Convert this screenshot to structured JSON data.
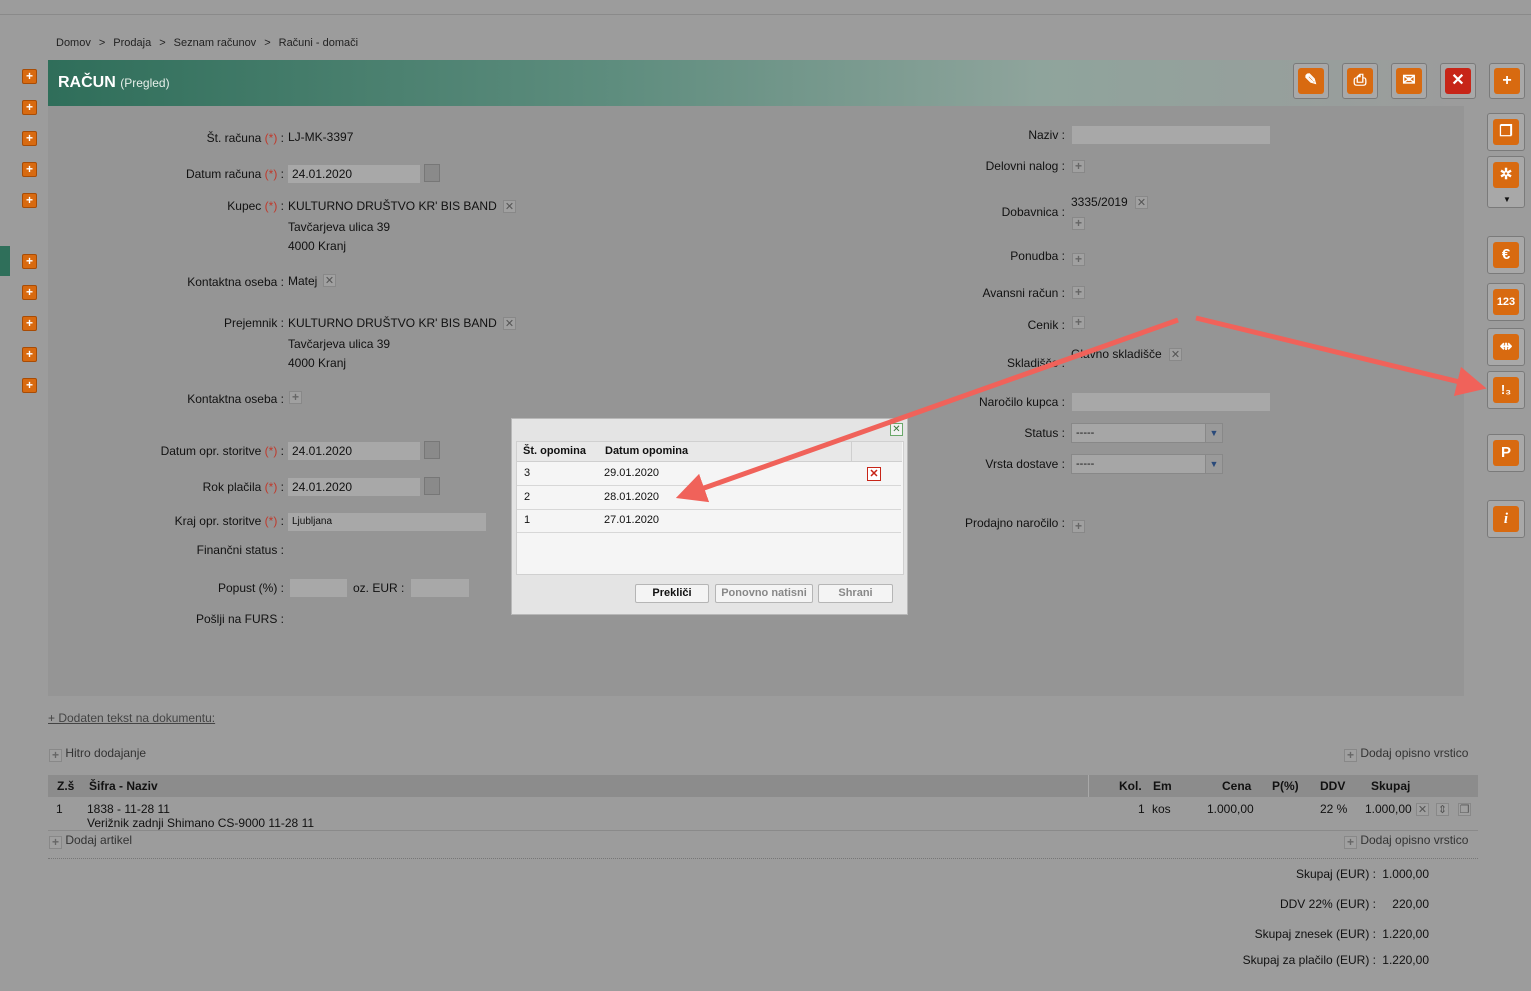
{
  "breadcrumb": {
    "items": [
      "Domov",
      "Prodaja",
      "Seznam računov",
      "Računi - domači"
    ],
    "separator": ">"
  },
  "header": {
    "title": "RAČUN",
    "subtitle": "(Pregled)"
  },
  "required_mark": "(*)",
  "form_left": {
    "st_racuna_label": "Št. računa",
    "st_racuna_value": "LJ-MK-3397",
    "datum_racuna_label": "Datum računa",
    "datum_racuna_value": "24.01.2020",
    "kupec_label": "Kupec",
    "kupec_name": "KULTURNO DRUŠTVO KR' BIS BAND",
    "kupec_street": "Tavčarjeva ulica 39",
    "kupec_city": "4000 Kranj",
    "kontaktna_label": "Kontaktna oseba :",
    "kontaktna_value": "Matej",
    "prejemnik_label": "Prejemnik :",
    "prejemnik_name": "KULTURNO DRUŠTVO KR' BIS BAND",
    "prejemnik_street": "Tavčarjeva ulica 39",
    "prejemnik_city": "4000 Kranj",
    "kontaktna2_label": "Kontaktna oseba :",
    "datum_opr_label": "Datum opr. storitve",
    "datum_opr_value": "24.01.2020",
    "rok_label": "Rok plačila",
    "rok_value": "24.01.2020",
    "kraj_label": "Kraj opr. storitve",
    "kraj_value": "Ljubljana",
    "financni_label": "Finančni status :",
    "popust_label": "Popust (%) :",
    "oz_eur_label": "oz. EUR :",
    "furs_label": "Pošlji na FURS :"
  },
  "form_right": {
    "naziv_label": "Naziv :",
    "delovni_label": "Delovni nalog :",
    "dobavnica_label": "Dobavnica :",
    "dobavnica_value": "3335/2019",
    "ponudba_label": "Ponudba :",
    "avansni_label": "Avansni račun :",
    "cenik_label": "Cenik :",
    "skladisce_label": "Skladišče :",
    "skladisce_value": "Glavno skladišče",
    "narocilo_label": "Naročilo kupca :",
    "status_label": "Status :",
    "status_value": "-----",
    "vrsta_label": "Vrsta dostave :",
    "vrsta_value": "-----",
    "prodajno_label": "Prodajno naročilo :"
  },
  "toolbar": {
    "edit": "pencil-icon",
    "print": "printer-icon",
    "email": "envelope-icon",
    "delete": "delete-icon",
    "add": "plus-icon"
  },
  "right_toolbar": {
    "copy_glyph": "❐",
    "settings_glyph": "✲",
    "euro_glyph": "€",
    "numbers_glyph": "123",
    "split_glyph": "⇹",
    "reminder_glyph": "!₃",
    "p_glyph": "P",
    "info_glyph": "i"
  },
  "links": {
    "dodaten_tekst": "+ Dodaten tekst na dokumentu:",
    "hitro": "Hitro dodajanje",
    "dodaj_opisno": "Dodaj opisno vrstico",
    "dodaj_artikel": "Dodaj artikel"
  },
  "items_table": {
    "headers": {
      "zs": "Z.š",
      "sifra": "Šifra - Naziv",
      "kol": "Kol.",
      "em": "Em",
      "cena": "Cena",
      "p": "P(%)",
      "ddv": "DDV",
      "skupaj": "Skupaj"
    },
    "rows": [
      {
        "zs": "1",
        "sifra": "1838 - 11-28 11",
        "naziv": "Verižnik zadnji Shimano CS-9000 11-28 11",
        "kol": "1",
        "em": "kos",
        "cena": "1.000,00",
        "ddv": "22 %",
        "skupaj": "1.000,00"
      }
    ]
  },
  "totals": {
    "skupaj_label": "Skupaj (EUR) :",
    "skupaj_value": "1.000,00",
    "ddv_label": "DDV 22% (EUR) :",
    "ddv_value": "220,00",
    "znesek_label": "Skupaj znesek (EUR) :",
    "znesek_value": "1.220,00",
    "placilo_label": "Skupaj za plačilo (EUR) :",
    "placilo_value": "1.220,00"
  },
  "dialog": {
    "header_num": "Št. opomina",
    "header_date": "Datum opomina",
    "rows": [
      {
        "num": "3",
        "date": "29.01.2020"
      },
      {
        "num": "2",
        "date": "28.01.2020"
      },
      {
        "num": "1",
        "date": "27.01.2020"
      }
    ],
    "cancel": "Prekliči",
    "reprint": "Ponovno natisni",
    "save": "Shrani"
  },
  "colors": {
    "accent_green": "#2f6e5a",
    "icon_orange": "#d86a10",
    "delete_red": "#c72518",
    "arrow": "#f0625a"
  }
}
